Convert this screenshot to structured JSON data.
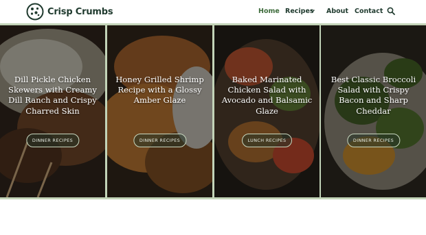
{
  "brand": {
    "name": "Crisp Crumbs",
    "logo_icon": "cookie-icon"
  },
  "nav": {
    "items": [
      {
        "label": "Home",
        "active": true
      },
      {
        "label": "Recipes",
        "has_dropdown": true
      },
      {
        "label": "About"
      },
      {
        "label": "Contact"
      }
    ],
    "search_icon": "search-icon"
  },
  "cards": [
    {
      "title": "Dill Pickle Chicken Skewers with Creamy Dill Ranch and Crispy Charred Skin",
      "category": "DINNER RECIPES"
    },
    {
      "title": "Honey Grilled Shrimp Recipe with a Glossy Amber Glaze",
      "category": "DINNER RECIPES"
    },
    {
      "title": "Baked Marinated Chicken Salad with Avocado and Balsamic Glaze",
      "category": "LUNCH RECIPES"
    },
    {
      "title": "Best Classic Broccoli Salad with Crispy Bacon and Sharp Cheddar",
      "category": "DINNER RECIPES"
    }
  ],
  "colors": {
    "brand_green": "#1f3a2e",
    "active_nav": "#3d6b3b",
    "accent_border": "#c3d4b8"
  }
}
